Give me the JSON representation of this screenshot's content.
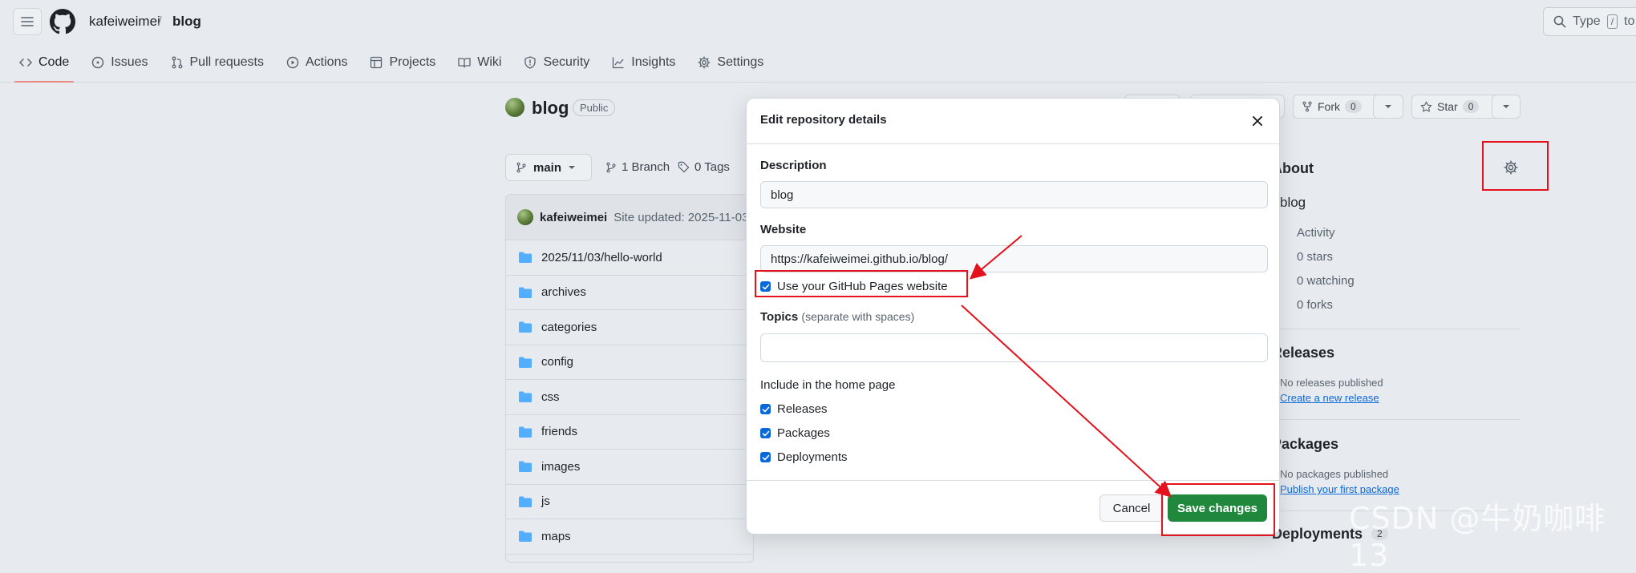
{
  "header": {
    "owner": "kafeiweimei",
    "separator": "/",
    "repo": "blog",
    "search_placeholder": "Type",
    "search_key": "/",
    "search_suffix": "to se"
  },
  "nav": [
    {
      "label": "Code",
      "icon": "code-icon"
    },
    {
      "label": "Issues",
      "icon": "issue-icon"
    },
    {
      "label": "Pull requests",
      "icon": "pull-request-icon"
    },
    {
      "label": "Actions",
      "icon": "play-icon"
    },
    {
      "label": "Projects",
      "icon": "table-icon"
    },
    {
      "label": "Wiki",
      "icon": "book-icon"
    },
    {
      "label": "Security",
      "icon": "shield-icon"
    },
    {
      "label": "Insights",
      "icon": "graph-icon"
    },
    {
      "label": "Settings",
      "icon": "gear-icon"
    }
  ],
  "repo": {
    "name": "blog",
    "visibility": "Public",
    "fork_label": "Fork",
    "fork_count": "0",
    "star_label": "Star",
    "star_count": "0",
    "branch": "main",
    "branch_count": "1 Branch",
    "tag_count": "0 Tags",
    "commit_author": "kafeiweimei",
    "commit_message": "Site updated: 2025-11-03",
    "files": [
      "2025/11/03/hello-world",
      "archives",
      "categories",
      "config",
      "css",
      "friends",
      "images",
      "js",
      "maps"
    ]
  },
  "sidebar": {
    "about_title": "About",
    "description": "blog",
    "activity": "Activity",
    "stars": "0 stars",
    "watching": "0 watching",
    "forks": "0 forks",
    "releases_title": "Releases",
    "releases_text": "No releases published",
    "releases_link": "Create a new release",
    "packages_title": "Packages",
    "packages_text": "No packages published",
    "packages_link": "Publish your first package",
    "deployments_title": "Deployments",
    "deployments_count": "2"
  },
  "modal": {
    "title": "Edit repository details",
    "description_label": "Description",
    "description_value": "blog",
    "website_label": "Website",
    "website_value": "https://kafeiweimei.github.io/blog/",
    "pages_checkbox": "Use your GitHub Pages website",
    "topics_label": "Topics",
    "topics_hint": "(separate with spaces)",
    "topics_value": "",
    "home_label": "Include in the home page",
    "home_options": [
      "Releases",
      "Packages",
      "Deployments"
    ],
    "cancel": "Cancel",
    "save": "Save changes"
  },
  "colors": {
    "accent_blue": "#0969da",
    "save_green": "#1f883d",
    "annotation_red": "#e4121c"
  },
  "watermark": "CSDN @牛奶咖啡13"
}
